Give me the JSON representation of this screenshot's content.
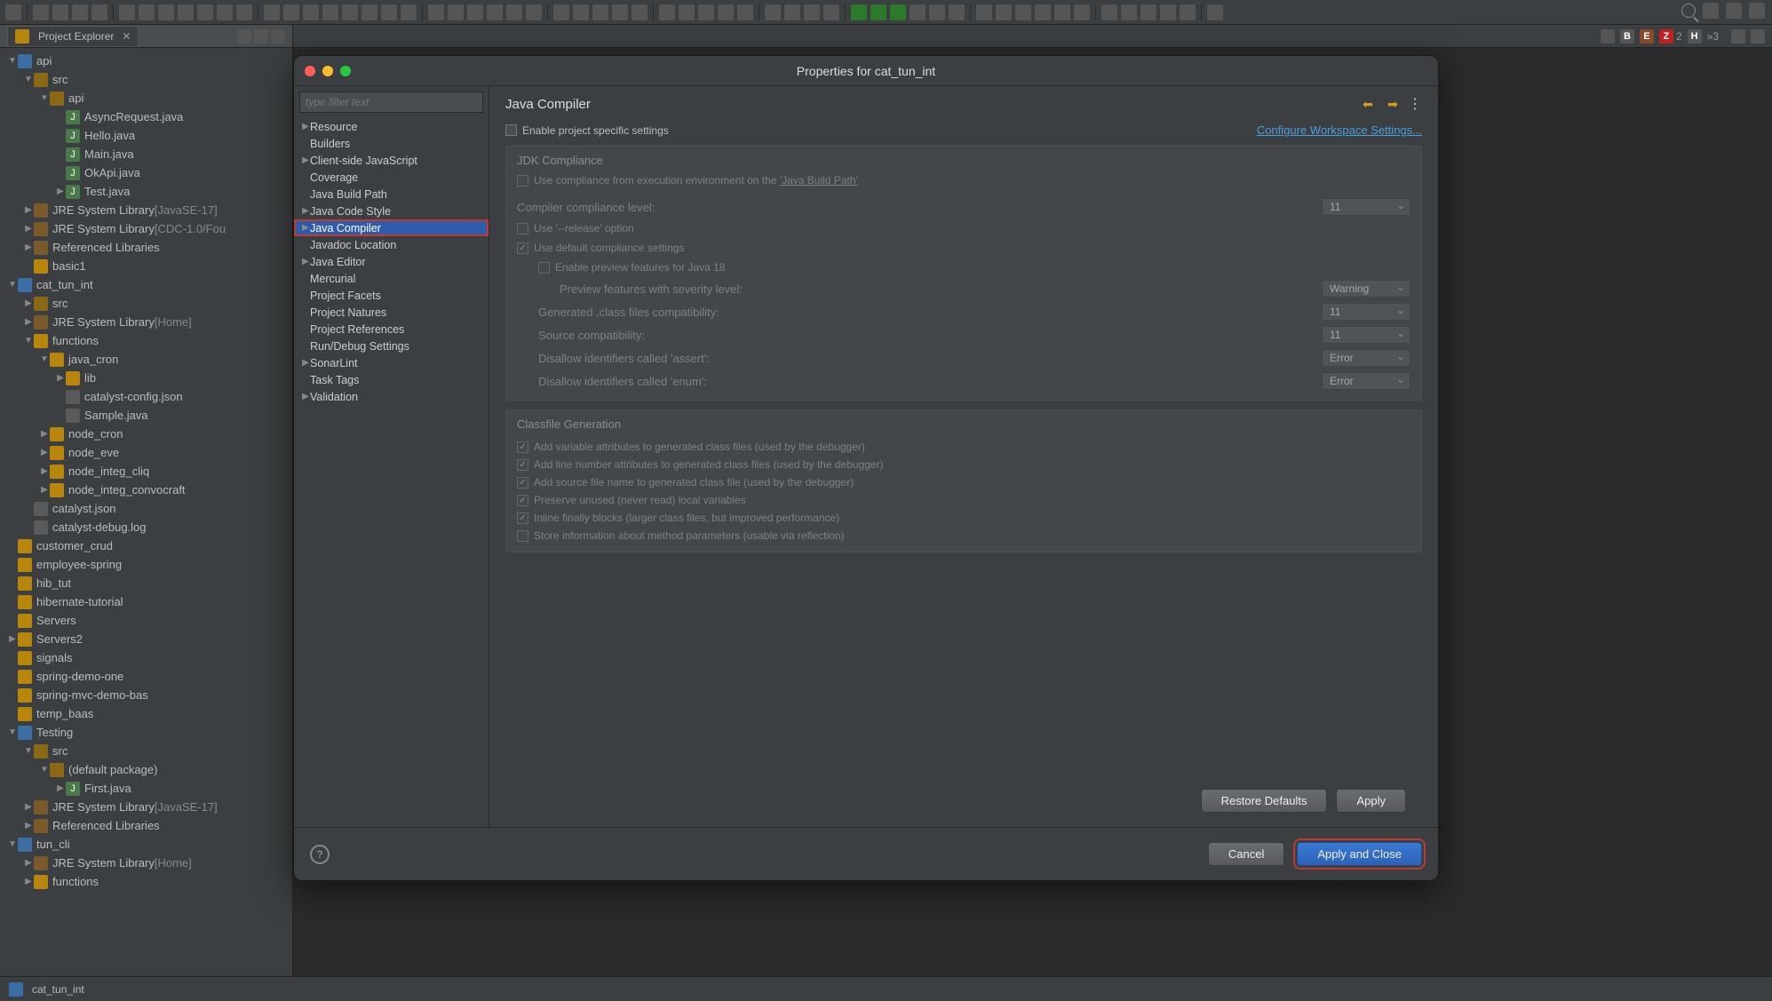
{
  "explorer": {
    "title": "Project Explorer",
    "tree": [
      {
        "d": 0,
        "a": "o",
        "i": "proj",
        "t": "api"
      },
      {
        "d": 1,
        "a": "o",
        "i": "pkg",
        "t": "src"
      },
      {
        "d": 2,
        "a": "o",
        "i": "pkg",
        "t": "api"
      },
      {
        "d": 3,
        "a": "n",
        "i": "java",
        "t": "AsyncRequest.java"
      },
      {
        "d": 3,
        "a": "n",
        "i": "java",
        "t": "Hello.java"
      },
      {
        "d": 3,
        "a": "n",
        "i": "java",
        "t": "Main.java"
      },
      {
        "d": 3,
        "a": "n",
        "i": "java",
        "t": "OkApi.java"
      },
      {
        "d": 3,
        "a": "c",
        "i": "java",
        "t": "Test.java"
      },
      {
        "d": 1,
        "a": "c",
        "i": "lib",
        "t": "JRE System Library",
        "suf": "[JavaSE-17]"
      },
      {
        "d": 1,
        "a": "c",
        "i": "lib",
        "t": "JRE System Library",
        "suf": "[CDC-1.0/Fou"
      },
      {
        "d": 1,
        "a": "c",
        "i": "lib",
        "t": "Referenced Libraries"
      },
      {
        "d": 1,
        "a": "n",
        "i": "folder",
        "t": "basic1"
      },
      {
        "d": 0,
        "a": "o",
        "i": "proj",
        "t": "cat_tun_int"
      },
      {
        "d": 1,
        "a": "c",
        "i": "pkg",
        "t": "src"
      },
      {
        "d": 1,
        "a": "c",
        "i": "lib",
        "t": "JRE System Library",
        "suf": "[Home]"
      },
      {
        "d": 1,
        "a": "o",
        "i": "folder",
        "t": "functions"
      },
      {
        "d": 2,
        "a": "o",
        "i": "folder",
        "t": "java_cron"
      },
      {
        "d": 3,
        "a": "c",
        "i": "folder",
        "t": "lib"
      },
      {
        "d": 3,
        "a": "n",
        "i": "file",
        "t": "catalyst-config.json"
      },
      {
        "d": 3,
        "a": "n",
        "i": "file",
        "t": "Sample.java"
      },
      {
        "d": 2,
        "a": "c",
        "i": "folder",
        "t": "node_cron"
      },
      {
        "d": 2,
        "a": "c",
        "i": "folder",
        "t": "node_eve"
      },
      {
        "d": 2,
        "a": "c",
        "i": "folder",
        "t": "node_integ_cliq"
      },
      {
        "d": 2,
        "a": "c",
        "i": "folder",
        "t": "node_integ_convocraft"
      },
      {
        "d": 1,
        "a": "n",
        "i": "file",
        "t": "catalyst.json"
      },
      {
        "d": 1,
        "a": "n",
        "i": "file",
        "t": "catalyst-debug.log"
      },
      {
        "d": 0,
        "a": "n",
        "i": "folder",
        "t": "customer_crud"
      },
      {
        "d": 0,
        "a": "n",
        "i": "folder",
        "t": "employee-spring"
      },
      {
        "d": 0,
        "a": "n",
        "i": "folder",
        "t": "hib_tut"
      },
      {
        "d": 0,
        "a": "n",
        "i": "folder",
        "t": "hibernate-tutorial"
      },
      {
        "d": 0,
        "a": "n",
        "i": "folder",
        "t": "Servers"
      },
      {
        "d": 0,
        "a": "c",
        "i": "folder",
        "t": "Servers2"
      },
      {
        "d": 0,
        "a": "n",
        "i": "folder",
        "t": "signals"
      },
      {
        "d": 0,
        "a": "n",
        "i": "folder",
        "t": "spring-demo-one"
      },
      {
        "d": 0,
        "a": "n",
        "i": "folder",
        "t": "spring-mvc-demo-bas"
      },
      {
        "d": 0,
        "a": "n",
        "i": "folder",
        "t": "temp_baas"
      },
      {
        "d": 0,
        "a": "o",
        "i": "proj",
        "t": "Testing"
      },
      {
        "d": 1,
        "a": "o",
        "i": "pkg",
        "t": "src"
      },
      {
        "d": 2,
        "a": "o",
        "i": "pkg",
        "t": "(default package)"
      },
      {
        "d": 3,
        "a": "c",
        "i": "java",
        "t": "First.java"
      },
      {
        "d": 1,
        "a": "c",
        "i": "lib",
        "t": "JRE System Library",
        "suf": "[JavaSE-17]"
      },
      {
        "d": 1,
        "a": "c",
        "i": "lib",
        "t": "Referenced Libraries"
      },
      {
        "d": 0,
        "a": "o",
        "i": "proj",
        "t": "tun_cli"
      },
      {
        "d": 1,
        "a": "c",
        "i": "lib",
        "t": "JRE System Library",
        "suf": "[Home]"
      },
      {
        "d": 1,
        "a": "c",
        "i": "folder",
        "t": "functions"
      }
    ]
  },
  "rightBadges": {
    "b": "B",
    "e": "E",
    "z": "Z",
    "z2": "2",
    "h": "H",
    "last": "»3"
  },
  "statusBar": {
    "project": "cat_tun_int"
  },
  "dialog": {
    "title": "Properties for cat_tun_int",
    "filterPlaceholder": "type filter text",
    "categories": [
      {
        "t": "Resource",
        "a": "c"
      },
      {
        "t": "Builders",
        "a": "n"
      },
      {
        "t": "Client-side JavaScript",
        "a": "c"
      },
      {
        "t": "Coverage",
        "a": "n"
      },
      {
        "t": "Java Build Path",
        "a": "n"
      },
      {
        "t": "Java Code Style",
        "a": "c"
      },
      {
        "t": "Java Compiler",
        "a": "c",
        "sel": true
      },
      {
        "t": "Javadoc Location",
        "a": "n"
      },
      {
        "t": "Java Editor",
        "a": "c"
      },
      {
        "t": "Mercurial",
        "a": "n"
      },
      {
        "t": "Project Facets",
        "a": "n"
      },
      {
        "t": "Project Natures",
        "a": "n"
      },
      {
        "t": "Project References",
        "a": "n"
      },
      {
        "t": "Run/Debug Settings",
        "a": "n"
      },
      {
        "t": "SonarLint",
        "a": "c"
      },
      {
        "t": "Task Tags",
        "a": "n"
      },
      {
        "t": "Validation",
        "a": "c"
      }
    ],
    "mainTitle": "Java Compiler",
    "enableProjectSpecific": "Enable project specific settings",
    "configureWorkspace": "Configure Workspace Settings...",
    "jdkCompliance": {
      "title": "JDK Compliance",
      "useFromEnv": "Use compliance from execution environment on the ",
      "jbpLink": "'Java Build Path'",
      "complianceLevel": "Compiler compliance level:",
      "complianceLevelVal": "11",
      "useRelease": "Use '--release' option",
      "useDefault": "Use default compliance settings",
      "enablePreview": "Enable preview features for Java 18",
      "previewSeverity": "Preview features with severity level:",
      "previewSeverityVal": "Warning",
      "generatedCompat": "Generated .class files compatibility:",
      "generatedCompatVal": "11",
      "sourceCompat": "Source compatibility:",
      "sourceCompatVal": "11",
      "disallowAssert": "Disallow identifiers called 'assert':",
      "disallowAssertVal": "Error",
      "disallowEnum": "Disallow identifiers called 'enum':",
      "disallowEnumVal": "Error"
    },
    "classfile": {
      "title": "Classfile Generation",
      "addVar": "Add variable attributes to generated class files (used by the debugger)",
      "addLine": "Add line number attributes to generated class files (used by the debugger)",
      "addSource": "Add source file name to generated class file (used by the debugger)",
      "preserve": "Preserve unused (never read) local variables",
      "inline": "Inline finally blocks (larger class files, but improved performance)",
      "storeParams": "Store information about method parameters (usable via reflection)"
    },
    "buttons": {
      "restoreDefaults": "Restore Defaults",
      "apply": "Apply",
      "cancel": "Cancel",
      "applyClose": "Apply and Close"
    }
  }
}
